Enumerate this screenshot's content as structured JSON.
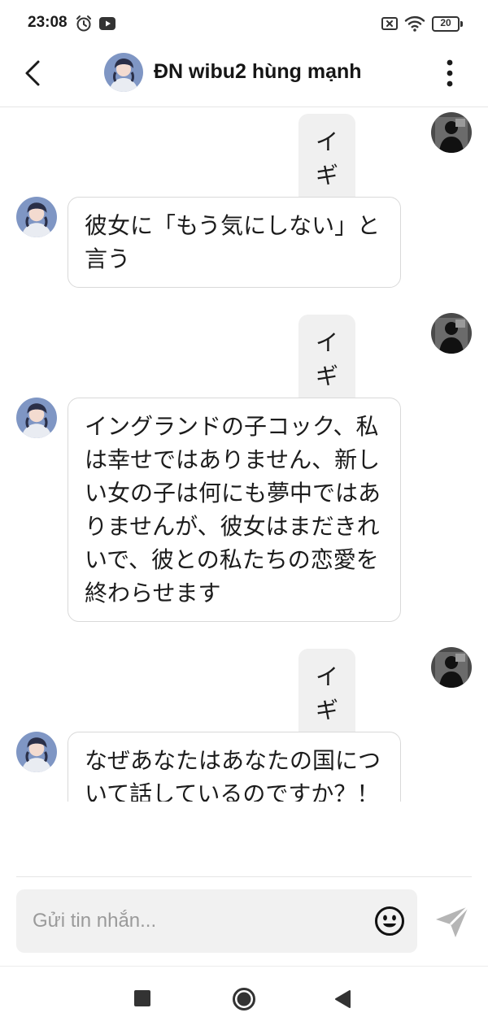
{
  "status_bar": {
    "time": "23:08",
    "battery": "20"
  },
  "header": {
    "title": "ĐN wibu2 hùng mạnh"
  },
  "messages": [
    {
      "role": "user",
      "text": "イギリス"
    },
    {
      "role": "bot",
      "text": "彼女に「もう気にしない」と\n言う"
    },
    {
      "role": "user",
      "text": "イギリス"
    },
    {
      "role": "bot",
      "text": "イングランドの子コック、私\nは幸せではありません、新し\nい女の子は何にも夢中ではあ\nりませんが、彼女はまだきれ\nいで、彼との私たちの恋愛を\n終わらせます"
    },
    {
      "role": "user",
      "text": "イギリス"
    },
    {
      "role": "bot",
      "text": "なぜあなたはあなたの国につ\nいて話しているのですか？！"
    }
  ],
  "composer": {
    "placeholder": "Gửi tin nhắn..."
  },
  "icons": {
    "back": "chevron-left-icon",
    "more": "more-vertical-icon",
    "emoji": "smiley-icon",
    "send": "send-icon",
    "nav_recents": "square-icon",
    "nav_home": "circle-icon",
    "nav_back": "triangle-back-icon"
  },
  "colors": {
    "bubble_user": "#f0f0f0",
    "bubble_bot_border": "#d9d9d9",
    "send_icon": "#b5b5b5"
  }
}
